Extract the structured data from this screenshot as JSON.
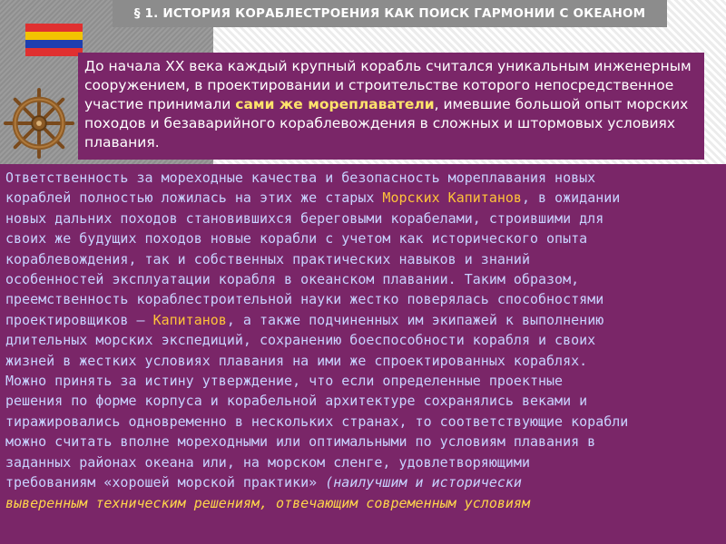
{
  "slide": {
    "title": "§ 1. ИСТОРИЯ КОРАБЛЕСТРОЕНИЯ КАК ПОИСК ГАРМОНИИ С ОКЕАНОМ",
    "colors": {
      "box_background": "#7a2668",
      "title_bar": "#8c8c8c",
      "highlight_top": "#ffe36b",
      "highlight_main": "#ffc23a",
      "main_text": "#c8d2ff",
      "flag_stripes": [
        "#e03030",
        "#f3c300",
        "#1e3fb0",
        "#e03030"
      ]
    },
    "icons": [
      "flag-icon",
      "ships-wheel-icon"
    ]
  },
  "intro": {
    "text_before": "До начала XX века каждый крупный корабль считался уникальным инженерным сооружением, в проектировании и строительстве которого непосредственное участие принимали ",
    "highlight": "сами же мореплаватели",
    "text_after": ", имевшие большой опыт морских походов и безаварийного кораблевождения в сложных и штормовых условиях плавания."
  },
  "main": {
    "lines": [
      {
        "before": "Ответственность за мореходные качества и безопасность мореплавания новых"
      },
      {
        "before": "кораблей полностью ложилась на этих же старых ",
        "highlight": "Морских Капитанов",
        "after": ", в ожидании"
      },
      {
        "before": "новых дальних походов становившихся береговыми корабелами, строившими для"
      },
      {
        "before": "своих же будущих походов новые корабли с учетом как исторического опыта"
      },
      {
        "before": "кораблевождения, так и собственных практических навыков и знаний"
      },
      {
        "before": "особенностей эксплуатации корабля в океанском плавании. Таким образом,"
      },
      {
        "before": "преемственность кораблестроительной науки жестко поверялась способностями"
      },
      {
        "before": "проектировщиков – ",
        "highlight": "Капитанов",
        "after": ", а также подчиненных им экипажей к выполнению"
      },
      {
        "before": "длительных морских экспедиций, сохранению боеспособности корабля и своих"
      },
      {
        "before": "жизней в жестких условиях плавания на ими же спроектированных кораблях."
      },
      {
        "before": "Можно принять за истину утверждение, что если определенные проектные"
      },
      {
        "before": "решения по форме корпуса и корабельной архитектуре сохранялись веками и"
      },
      {
        "before": "тиражировались одновременно в нескольких странах, то соответствующие корабли"
      },
      {
        "before": "можно считать вполне мореходными или оптимальными по условиям плавания в"
      },
      {
        "before": "заданных районах океана или, на морском сленге, удовлетворяющими"
      },
      {
        "before": "требованиям «хорошей морской практики» ",
        "italic": "(наилучшим и исторически"
      },
      {
        "italic": "выверенным техническим решениям, отвечающим современным условиям"
      }
    ]
  }
}
